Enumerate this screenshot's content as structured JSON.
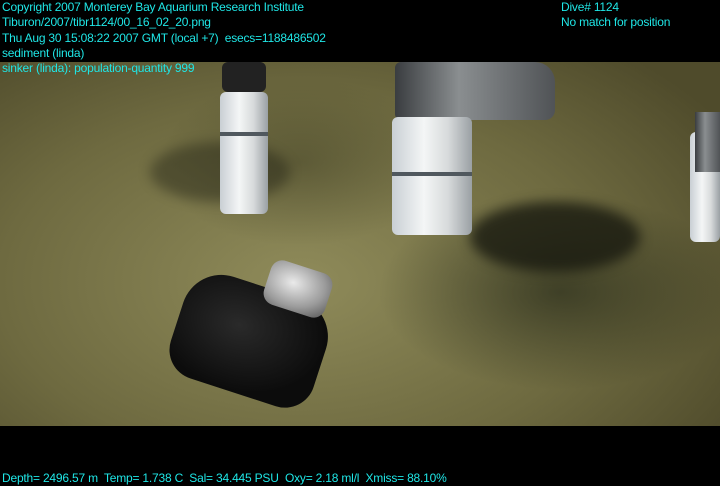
{
  "overlay": {
    "copyright": "Copyright 2007 Monterey Bay Aquarium Research Institute",
    "file_path": "Tiburon/2007/tibr1124/00_16_02_20.png",
    "timestamp": "Thu Aug 30 15:08:22 2007 GMT (local +7)  esecs=1188486502",
    "annotation_1": "sediment (linda)",
    "annotation_2": "sinker (linda): population-quantity 999",
    "dive": "Dive# 1124",
    "position": "No match for position",
    "sensors": "Depth= 2496.57 m  Temp= 1.738 C  Sal= 34.445 PSU  Oxy= 2.18 ml/l  Xmiss= 88.10%"
  }
}
